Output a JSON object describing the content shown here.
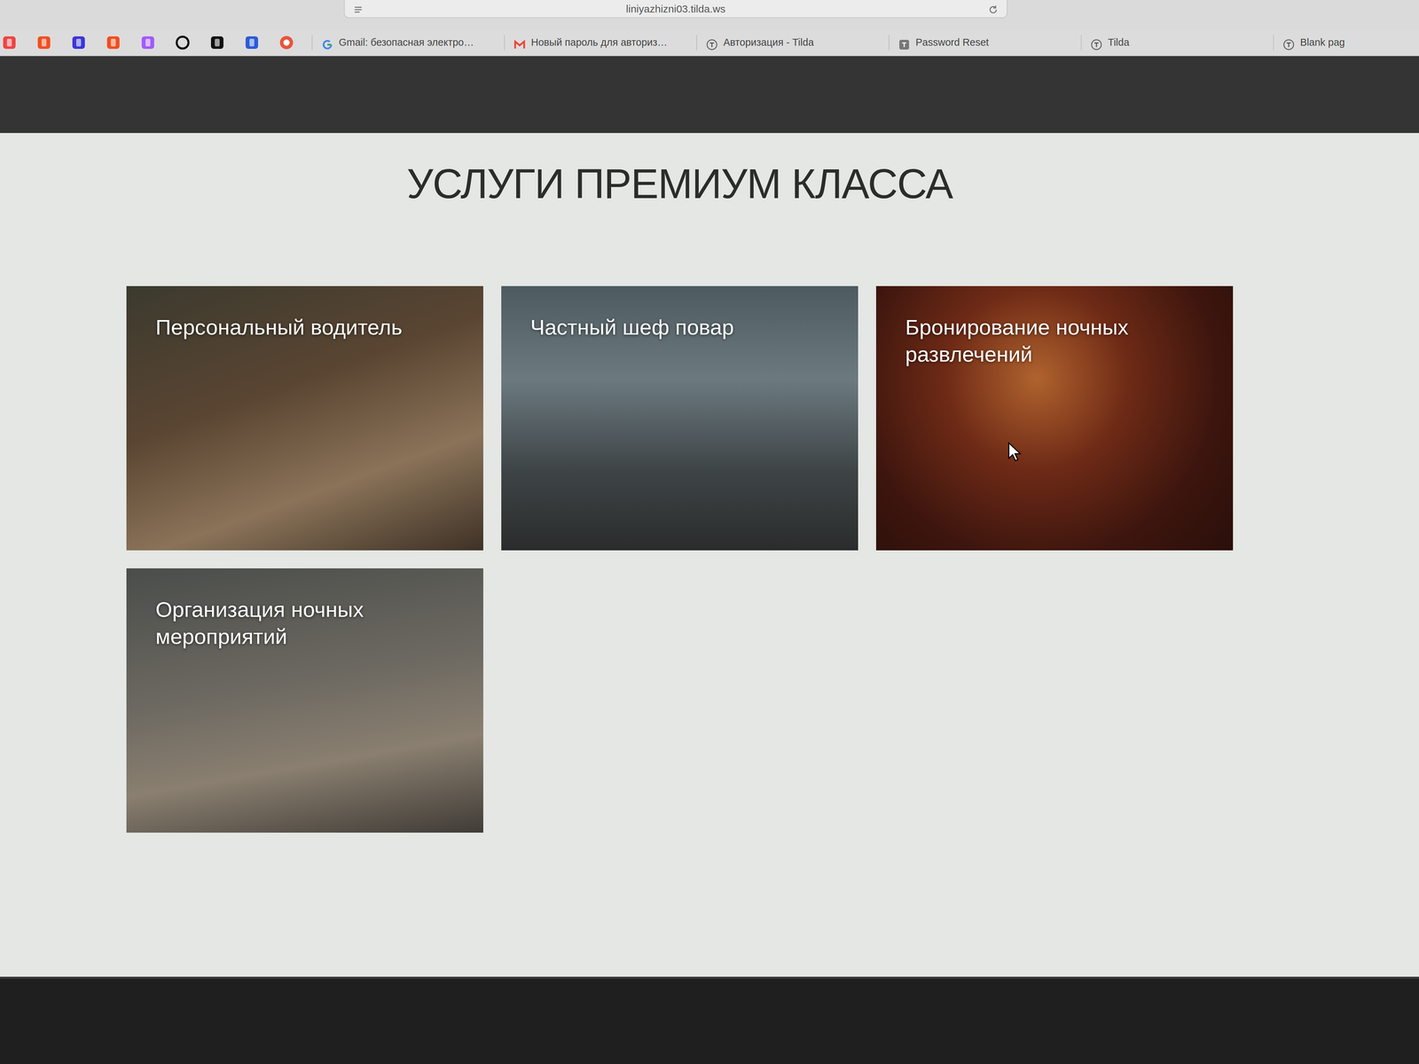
{
  "browser": {
    "address": "liniyazhizni03.tilda.ws",
    "tabs": [
      {
        "label": "Gmail: безопасная электро…",
        "selected": false
      },
      {
        "label": "Новый пароль для авториз…",
        "selected": false
      },
      {
        "label": "Авторизация - Tilda",
        "selected": false
      },
      {
        "label": "Password Reset",
        "selected": false
      },
      {
        "label": "Tilda",
        "selected": false
      },
      {
        "label": "Blank pag",
        "selected": false
      }
    ]
  },
  "section": {
    "title": "УСЛУГИ ПРЕМИУМ КЛАССА",
    "cards": [
      {
        "label": "Персональный водитель"
      },
      {
        "label": "Частный шеф повар"
      },
      {
        "label": "Бронирование ночных развлечений"
      },
      {
        "label": "Организация ночных мероприятий"
      }
    ]
  }
}
